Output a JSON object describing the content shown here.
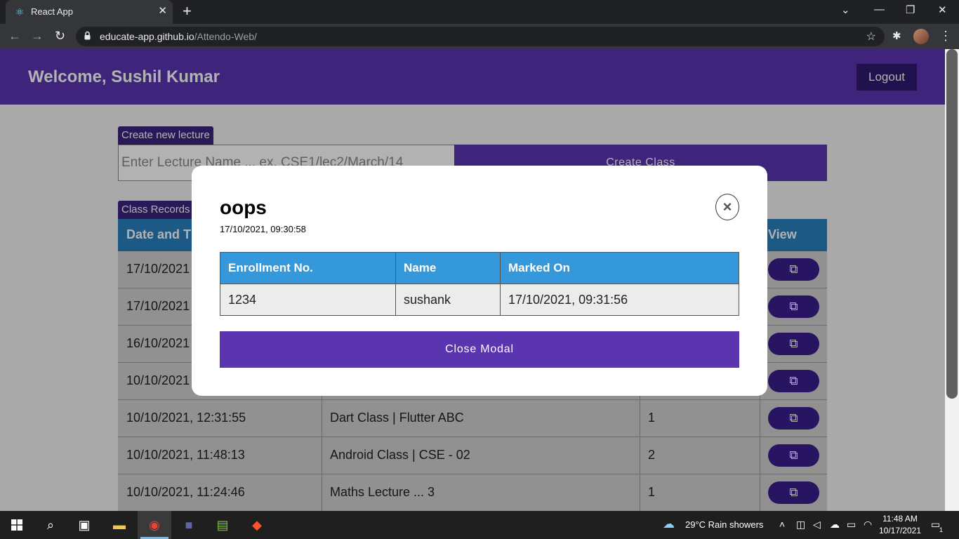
{
  "browser": {
    "tab_title": "React App",
    "url_host": "educate-app.github.io",
    "url_path": "/Attendo-Web/"
  },
  "header": {
    "welcome": "Welcome, Sushil Kumar",
    "logout": "Logout"
  },
  "create": {
    "label": "Create new lecture",
    "placeholder": "Enter Lecture Name ... ex. CSE1/lec2/March/14",
    "button": "Create Class"
  },
  "records": {
    "label": "Class Records",
    "headers": [
      "Date and T",
      "View"
    ],
    "rows": [
      {
        "date": "17/10/2021",
        "name": "",
        "count": ""
      },
      {
        "date": "17/10/2021",
        "name": "",
        "count": ""
      },
      {
        "date": "16/10/2021",
        "name": "",
        "count": ""
      },
      {
        "date": "10/10/2021",
        "name": "",
        "count": ""
      },
      {
        "date": "10/10/2021, 12:31:55",
        "name": "Dart Class | Flutter ABC",
        "count": "1"
      },
      {
        "date": "10/10/2021, 11:48:13",
        "name": "Android Class | CSE - 02",
        "count": "2"
      },
      {
        "date": "10/10/2021, 11:24:46",
        "name": "Maths Lecture ... 3",
        "count": "1"
      }
    ]
  },
  "modal": {
    "title": "oops",
    "subtitle": "17/10/2021, 09:30:58",
    "close_symbol": "×",
    "columns": [
      "Enrollment No.",
      "Name",
      "Marked On"
    ],
    "rows": [
      {
        "enrollment": "1234",
        "name": "sushank",
        "marked_on": "17/10/2021, 09:31:56"
      }
    ],
    "button": "Close Modal"
  },
  "taskbar": {
    "weather": "29°C  Rain showers",
    "time": "11:48 AM",
    "date": "10/17/2021",
    "notification_count": "1"
  },
  "colors": {
    "primary": "#5b34b0",
    "dark_primary": "#2e1a72",
    "table_header": "#3498db"
  }
}
